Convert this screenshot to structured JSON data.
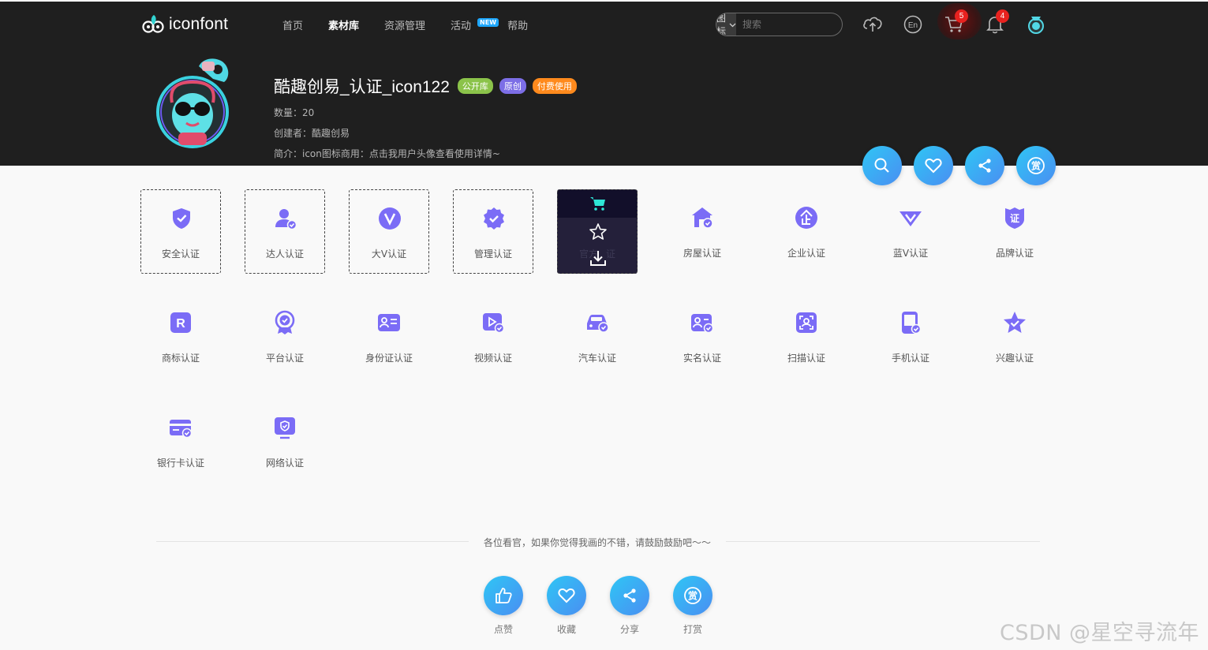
{
  "header": {
    "logo_text": "iconfont",
    "nav": [
      "首页",
      "素材库",
      "资源管理",
      "活动",
      "帮助"
    ],
    "nav_new_badge": "NEW",
    "search_type": "图标",
    "search_placeholder": "搜索",
    "cart_count": "5",
    "notify_count": "4",
    "lang_label": "En"
  },
  "project": {
    "title": "酷趣创易_认证_icon122",
    "tags": [
      "公开库",
      "原创",
      "付费使用"
    ],
    "count": "数量：20",
    "creator": "创建者：酷趣创易",
    "intro": "简介：icon图标商用：点击我用户头像查看使用详情~"
  },
  "icons": [
    {
      "label": "安全认证",
      "icon": "shield-check-icon"
    },
    {
      "label": "达人认证",
      "icon": "user-check-icon"
    },
    {
      "label": "大V认证",
      "icon": "v-circle-icon"
    },
    {
      "label": "管理认证",
      "icon": "badge-check-icon"
    },
    {
      "label": "官方认证",
      "icon": "official-icon"
    },
    {
      "label": "房屋认证",
      "icon": "house-check-icon"
    },
    {
      "label": "企业认证",
      "icon": "enterprise-icon"
    },
    {
      "label": "蓝V认证",
      "icon": "blue-v-icon"
    },
    {
      "label": "品牌认证",
      "icon": "brand-certificate-icon"
    },
    {
      "label": "商标认证",
      "icon": "trademark-r-icon"
    },
    {
      "label": "平台认证",
      "icon": "platform-medal-icon"
    },
    {
      "label": "身份证认证",
      "icon": "id-card-icon"
    },
    {
      "label": "视频认证",
      "icon": "video-check-icon"
    },
    {
      "label": "汽车认证",
      "icon": "car-check-icon"
    },
    {
      "label": "实名认证",
      "icon": "realname-icon"
    },
    {
      "label": "扫描认证",
      "icon": "scan-face-icon"
    },
    {
      "label": "手机认证",
      "icon": "phone-check-icon"
    },
    {
      "label": "兴趣认证",
      "icon": "star-check-icon"
    },
    {
      "label": "银行卡认证",
      "icon": "bank-card-icon"
    },
    {
      "label": "网络认证",
      "icon": "network-shield-icon"
    }
  ],
  "hover_label_fragments": [
    "官方",
    "证"
  ],
  "footer": {
    "message": "各位看官，如果你觉得我画的不错，请鼓励鼓励吧～～",
    "buttons": [
      "点赞",
      "收藏",
      "分享",
      "打赏"
    ]
  },
  "reward_glyph": "赏",
  "watermark": "CSDN @星空寻流年",
  "colors": {
    "header_bg": "#1f1f1f",
    "icon_purple": "#7b6cf6",
    "fab_gradient_start": "#2fc6f5",
    "fab_gradient_end": "#4a8ef2",
    "tag_green": "#8bc34a",
    "tag_purple": "#7c6ee6",
    "tag_orange": "#ff8a1d"
  }
}
